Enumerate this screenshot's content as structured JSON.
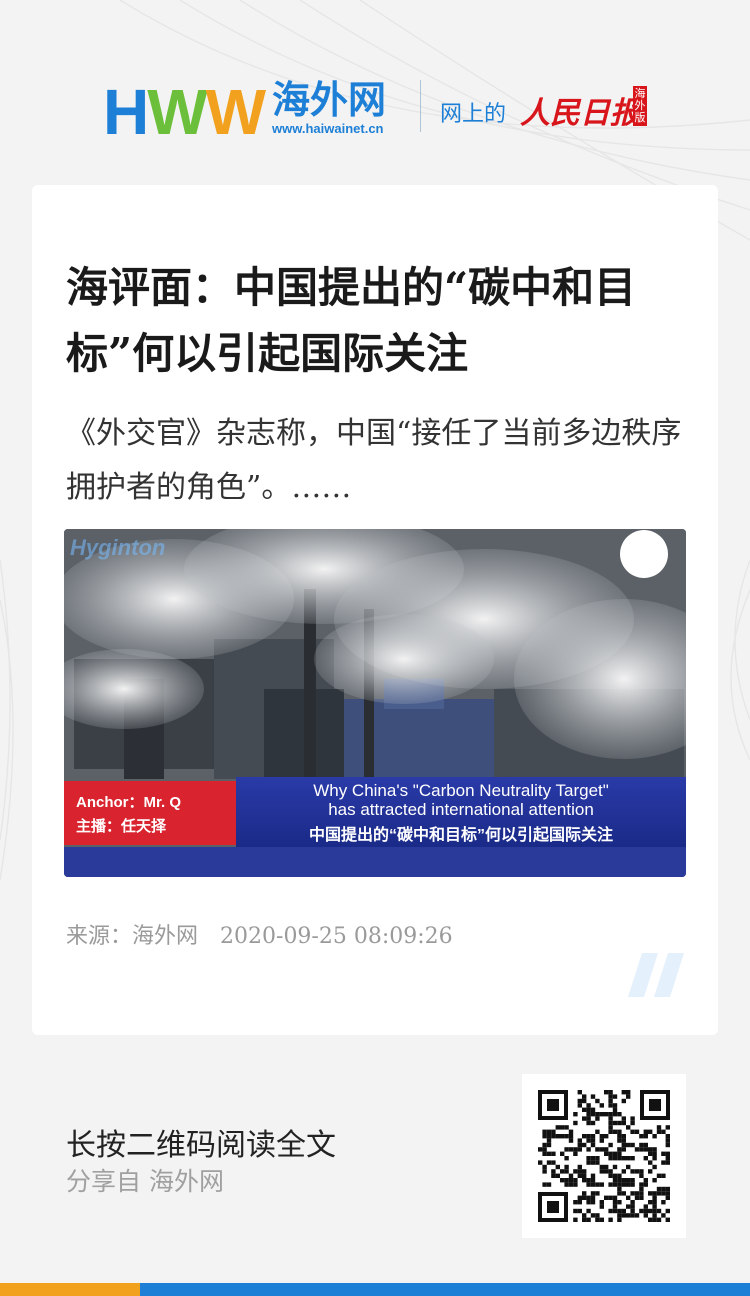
{
  "header": {
    "logo_letters": [
      "H",
      "W",
      "W"
    ],
    "logo_name": "海外网",
    "logo_url": "www.haiwainet.cn",
    "online_text": "网上的",
    "people_daily": "人民日报",
    "edition": "海外版"
  },
  "article": {
    "title": "海评面：中国提出的“碳中和目标”何以引起国际关注",
    "summary": "《外交官》杂志称，中国“接任了当前多边秩序拥护者的角色”。……",
    "image": {
      "brand_mark": "Hyginton",
      "anchor_line1": "Anchor：Mr. Q",
      "anchor_line2": "主播：任天择",
      "caption_en_line1": "Why China's \"Carbon Neutrality Target\"",
      "caption_en_line2": "has attracted international attention",
      "caption_cn": "中国提出的“碳中和目标”何以引起国际关注"
    },
    "source_label": "来源：海外网",
    "date": "2020-09-25 08:09:26"
  },
  "share": {
    "cta": "长按二维码阅读全文",
    "from": "分享自 海外网"
  },
  "colors": {
    "brand_blue": "#1d7fd6",
    "brand_green": "#6cbf3a",
    "brand_orange": "#f2a11f",
    "people_red": "#d8151b"
  }
}
